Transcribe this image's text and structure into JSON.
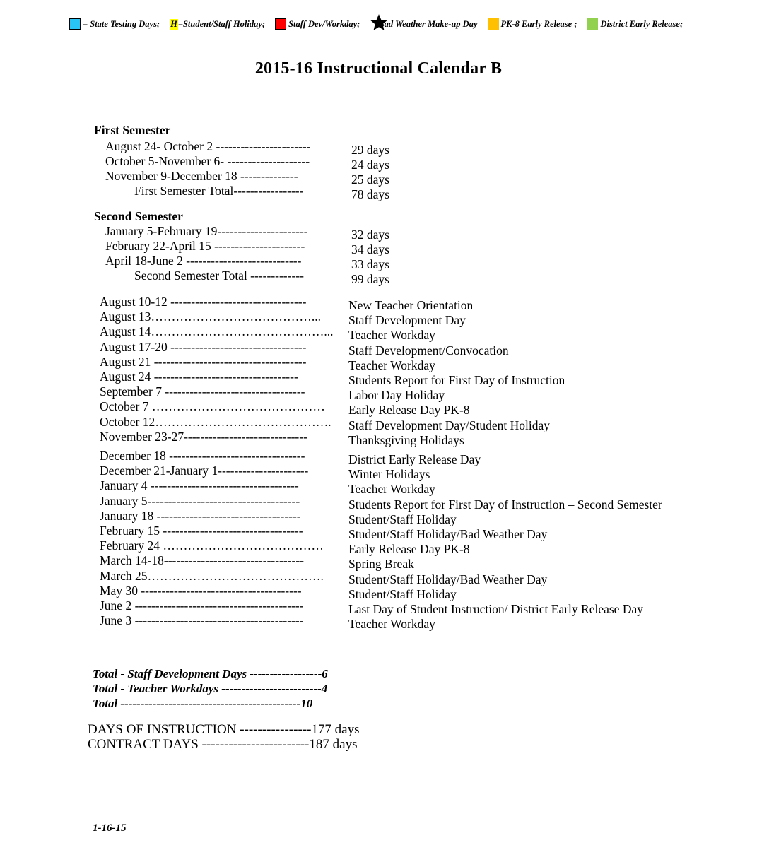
{
  "legend": {
    "items": [
      {
        "swatch": "cyan-swatch",
        "color": "#29C5F6",
        "bordered": true,
        "text": "= State Testing Days;"
      },
      {
        "swatch": "h-highlight",
        "color": "#FFFF00",
        "bordered": false,
        "text": "=Student/Staff Holiday;",
        "marker": "H"
      },
      {
        "swatch": "red-swatch",
        "color": "#FF0000",
        "bordered": true,
        "text": "Staff Dev/Workday;"
      },
      {
        "swatch": "star-icon",
        "color": "#000000",
        "bordered": false,
        "text": "Bad Weather Make-up Day",
        "marker": "★"
      },
      {
        "swatch": "orange-swatch",
        "color": "#FFC000",
        "bordered": false,
        "text": "PK-8 Early Release ;"
      },
      {
        "swatch": "green-swatch",
        "color": "#92D050",
        "bordered": false,
        "text": "District Early Release;"
      }
    ]
  },
  "title": "2015-16 Instructional Calendar B",
  "first_semester": {
    "heading": "First Semester",
    "rows": [
      {
        "label": "August 24- October 2 -----------------------",
        "value": "29 days"
      },
      {
        "label": "October 5-November 6- --------------------",
        "value": "24 days"
      },
      {
        "label": "November 9-December 18 --------------",
        "value": "25 days"
      },
      {
        "label": "First Semester Total-----------------",
        "value": "78 days",
        "indent": true
      }
    ]
  },
  "second_semester": {
    "heading": "Second Semester",
    "rows": [
      {
        "label": "January 5-February 19----------------------",
        "value": "32 days"
      },
      {
        "label": "February 22-April 15 ----------------------",
        "value": "34 days"
      },
      {
        "label": "April 18-June 2  ----------------------------",
        "value": "33 days"
      },
      {
        "label": "Second Semester Total -------------",
        "value": "99 days",
        "indent": true
      }
    ]
  },
  "events": [
    {
      "date": "August 10-12 ---------------------------------",
      "desc": "New Teacher Orientation"
    },
    {
      "date": "August 13…………………………………...",
      "desc": "Staff Development Day"
    },
    {
      "date": "August 14……………………………………...",
      "desc": "Teacher Workday"
    },
    {
      "date": "August 17-20 ---------------------------------",
      "desc": "Staff Development/Convocation"
    },
    {
      "date": "August 21 -------------------------------------",
      "desc": "Teacher Workday"
    },
    {
      "date": "August 24   -----------------------------------",
      "desc": "Students Report for First Day of Instruction"
    },
    {
      "date": "September 7 ----------------------------------",
      "desc": "Labor Day Holiday"
    },
    {
      "date": "October 7 ……………………………………",
      "desc": "Early Release Day PK-8"
    },
    {
      "date": "October 12…………………………………….",
      "desc": "Staff Development Day/Student Holiday"
    },
    {
      "date": "November 23-27------------------------------",
      "desc": "Thanksgiving Holidays"
    },
    {
      "date": "December 18 ---------------------------------",
      "desc": "District Early Release Day",
      "gap": true
    },
    {
      "date": "December 21-January 1----------------------",
      "desc": "Winter Holidays"
    },
    {
      "date": "January 4  ------------------------------------",
      "desc": "Teacher Workday"
    },
    {
      "date": "January 5-------------------------------------",
      "desc": "Students Report for First Day of Instruction – Second Semester"
    },
    {
      "date": "January 18 -----------------------------------",
      "desc": "Student/Staff Holiday"
    },
    {
      "date": "February 15 ----------------------------------",
      "desc": "Student/Staff Holiday/Bad Weather Day"
    },
    {
      "date": "February 24 …………………………………",
      "desc": "Early Release Day PK-8"
    },
    {
      "date": "March 14-18----------------------------------",
      "desc": "Spring Break"
    },
    {
      "date": "March 25…………………………………….",
      "desc": "Student/Staff Holiday/Bad Weather Day"
    },
    {
      "date": "May 30 ---------------------------------------",
      "desc": "Student/Staff Holiday"
    },
    {
      "date": "June 2 -----------------------------------------",
      "desc": "Last Day of Student Instruction/ District Early Release Day"
    },
    {
      "date": "June 3 -----------------------------------------",
      "desc": "Teacher Workday"
    }
  ],
  "totals": [
    "Total - Staff Development Days ------------------6",
    "Total - Teacher Workdays -------------------------4",
    "Total  ---------------------------------------------10"
  ],
  "summary": [
    "DAYS OF INSTRUCTION ----------------177 days",
    "CONTRACT DAYS ------------------------187 days"
  ],
  "footer": "1-16-15"
}
